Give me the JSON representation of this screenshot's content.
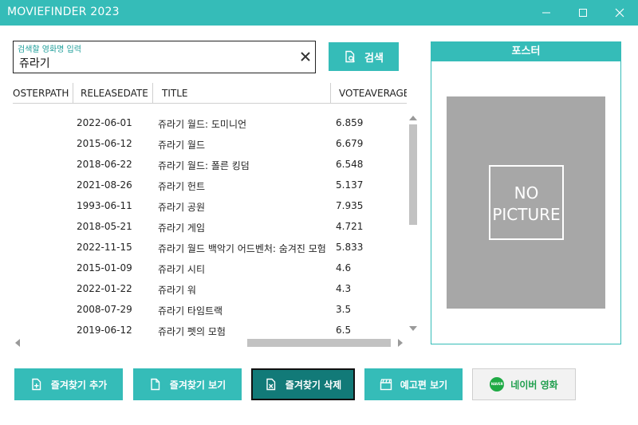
{
  "window": {
    "title": "MOVIEFINDER 2023"
  },
  "search": {
    "hint": "검색할 영화명 입력",
    "value": "쥬라기",
    "button_label": "검색"
  },
  "grid": {
    "columns": [
      "OSTERPATH",
      "RELEASEDATE",
      "TITLE",
      "VOTEAVERAGE"
    ],
    "rows": [
      {
        "releasedate": "2022-06-01",
        "title": "쥬라기 월드: 도미니언",
        "vote": "6.859"
      },
      {
        "releasedate": "2015-06-12",
        "title": "쥬라기 월드",
        "vote": "6.679"
      },
      {
        "releasedate": "2018-06-22",
        "title": "쥬라기 월드: 폴른 킹덤",
        "vote": "6.548"
      },
      {
        "releasedate": "2021-08-26",
        "title": "쥬라기 헌트",
        "vote": "5.137"
      },
      {
        "releasedate": "1993-06-11",
        "title": "쥬라기 공원",
        "vote": "7.935"
      },
      {
        "releasedate": "2018-05-21",
        "title": "쥬라기 게임",
        "vote": "4.721"
      },
      {
        "releasedate": "2022-11-15",
        "title": "쥬라기 월드 백악기 어드벤처: 숨겨진 모험",
        "vote": "5.833"
      },
      {
        "releasedate": "2015-01-09",
        "title": "쥬라기 시티",
        "vote": "4.6"
      },
      {
        "releasedate": "2022-01-22",
        "title": "쥬라기 워",
        "vote": "4.3"
      },
      {
        "releasedate": "2008-07-29",
        "title": "쥬라기 타임트랙",
        "vote": "3.5"
      },
      {
        "releasedate": "2019-06-12",
        "title": "쥬라기 펫의 모험",
        "vote": "6.5"
      }
    ]
  },
  "poster": {
    "header": "포스터",
    "placeholder_line1": "NO",
    "placeholder_line2": "PICTURE"
  },
  "buttons": {
    "add_favorite": "즐겨찾기 추가",
    "view_favorites": "즐겨찾기 보기",
    "delete_favorite": "즐겨찾기 삭제",
    "trailer": "예고편 보기",
    "naver_movie": "네이버 영화",
    "naver_logo_text": "NAVER"
  },
  "colors": {
    "accent": "#35bcb8",
    "accent_dark": "#127a78",
    "naver_green": "#1faa45"
  },
  "icons": {
    "search_button": "file-search-icon",
    "add": "file-add-icon",
    "view": "file-icon",
    "delete": "file-delete-icon",
    "trailer": "clapperboard-icon",
    "naver": "naver-logo"
  }
}
